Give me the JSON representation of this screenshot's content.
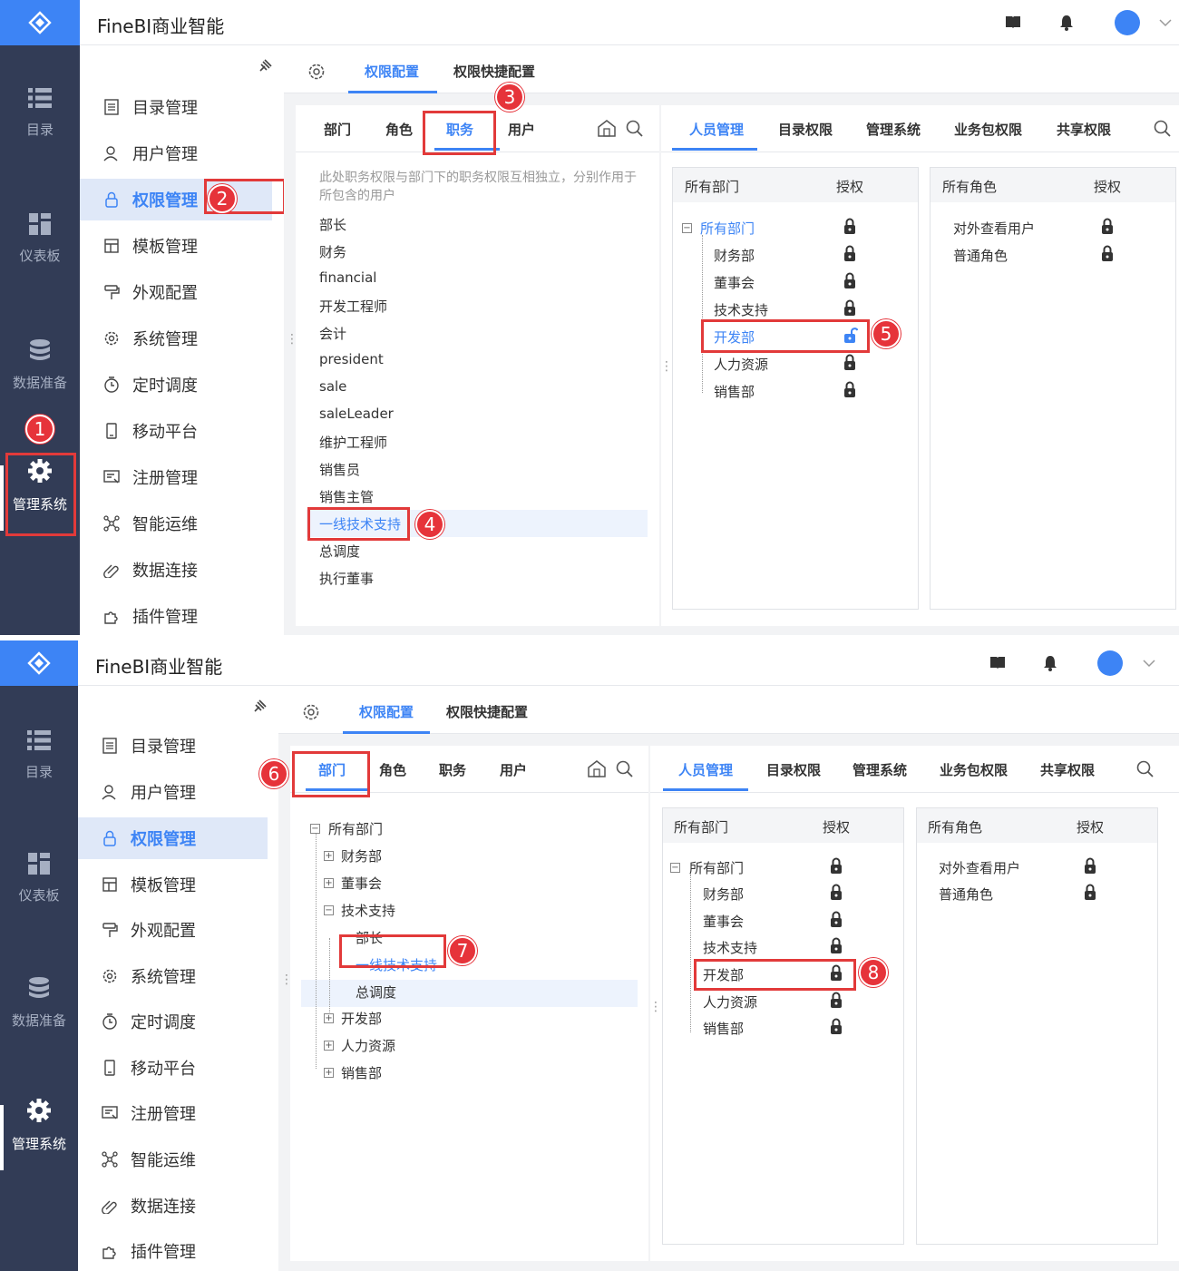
{
  "app_title": "FineBI商业智能",
  "rail": [
    "目录",
    "仪表板",
    "数据准备",
    "管理系统"
  ],
  "menu": [
    "目录管理",
    "用户管理",
    "权限管理",
    "模板管理",
    "外观配置",
    "系统管理",
    "定时调度",
    "移动平台",
    "注册管理",
    "智能运维",
    "数据连接",
    "插件管理"
  ],
  "top_tabs": [
    "权限配置",
    "权限快捷配置"
  ],
  "left_tabs": [
    "部门",
    "角色",
    "职务",
    "用户"
  ],
  "right_tabs": [
    "人员管理",
    "目录权限",
    "管理系统",
    "业务包权限",
    "共享权限"
  ],
  "job_hint": "此处职务权限与部门下的职务权限互相独立，分别作用于所包含的用户",
  "jobs": [
    "部长",
    "财务",
    "financial",
    "开发工程师",
    "会计",
    "president",
    "sale",
    "saleLeader",
    "维护工程师",
    "销售员",
    "销售主管",
    "一线技术支持",
    "总调度",
    "执行董事"
  ],
  "dept_header": {
    "name": "所有部门",
    "auth": "授权"
  },
  "role_header": {
    "name": "所有角色",
    "auth": "授权"
  },
  "dept_root": "所有部门",
  "depts": [
    "财务部",
    "董事会",
    "技术支持",
    "开发部",
    "人力资源",
    "销售部"
  ],
  "roles": [
    "对外查看用户",
    "普通角色"
  ],
  "tree_left": {
    "root": "所有部门",
    "nodes": [
      "财务部",
      "董事会",
      "技术支持"
    ],
    "children": [
      "部长",
      "一线技术支持",
      "总调度"
    ],
    "after": [
      "开发部",
      "人力资源",
      "销售部"
    ]
  },
  "badges": [
    "1",
    "2",
    "3",
    "4",
    "5",
    "6",
    "7",
    "8"
  ],
  "colors": {
    "accent": "#3d84f5",
    "rail": "#323c56",
    "highlight": "#e23a3a"
  }
}
